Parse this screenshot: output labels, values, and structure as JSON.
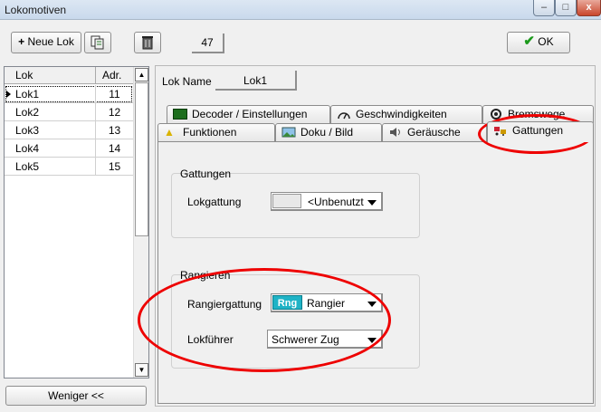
{
  "window": {
    "title": "Lokomotiven",
    "close_label": "x"
  },
  "toolbar": {
    "new_lok_label": "Neue Lok",
    "count": "47",
    "ok_label": "OK"
  },
  "list": {
    "columns": [
      "Lok",
      "Adr."
    ],
    "rows": [
      {
        "name": "Lok1",
        "addr": "11"
      },
      {
        "name": "Lok2",
        "addr": "12"
      },
      {
        "name": "Lok3",
        "addr": "13"
      },
      {
        "name": "Lok4",
        "addr": "14"
      },
      {
        "name": "Lok5",
        "addr": "15"
      }
    ],
    "less_label": "Weniger <<"
  },
  "detail": {
    "lok_name_label": "Lok Name",
    "lok_name_value": "Lok1",
    "tabs_row1": [
      "Decoder / Einstellungen",
      "Geschwindigkeiten",
      "Bremswege"
    ],
    "tabs_row2": [
      "Funktionen",
      "Doku / Bild",
      "Geräusche",
      "Gattungen"
    ],
    "active_tab": "Gattungen",
    "gattungen_group": {
      "title": "Gattungen",
      "lokgattung_label": "Lokgattung",
      "lokgattung_value": "<Unbenutzt"
    },
    "rangieren_group": {
      "title": "Rangieren",
      "rangiergattung_label": "Rangiergattung",
      "rangiergattung_badge": "Rng",
      "rangiergattung_value": "Rangier",
      "lokfuehrer_label": "Lokführer",
      "lokfuehrer_value": "Schwerer Zug"
    }
  },
  "colors": {
    "badge_bg": "#1fb3c6",
    "highlight_ring": "#e00000"
  }
}
